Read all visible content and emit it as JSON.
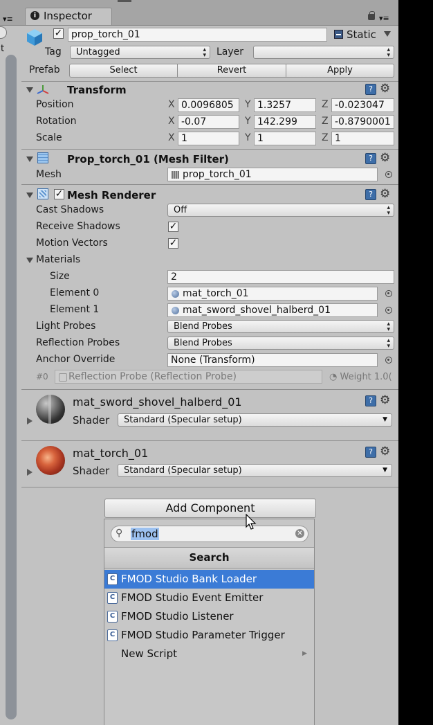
{
  "tab": {
    "title": "Inspector"
  },
  "header": {
    "object_name": "prop_torch_01",
    "static_label": "Static",
    "tag_label": "Tag",
    "tag_value": "Untagged",
    "layer_label": "Layer",
    "layer_value": "",
    "prefab_label": "Prefab",
    "select_label": "Select",
    "revert_label": "Revert",
    "apply_label": "Apply"
  },
  "transform": {
    "title": "Transform",
    "rows": [
      {
        "label": "Position",
        "x": "0.0096805",
        "y": "1.3257",
        "z": "-0.023047"
      },
      {
        "label": "Rotation",
        "x": "-0.07",
        "y": "142.299",
        "z": "-0.8790001"
      },
      {
        "label": "Scale",
        "x": "1",
        "y": "1",
        "z": "1"
      }
    ],
    "axis_x": "X",
    "axis_y": "Y",
    "axis_z": "Z"
  },
  "mesh_filter": {
    "title": "Prop_torch_01 (Mesh Filter)",
    "mesh_label": "Mesh",
    "mesh_value": "prop_torch_01"
  },
  "mesh_renderer": {
    "title": "Mesh Renderer",
    "cast_shadows_label": "Cast Shadows",
    "cast_shadows_value": "Off",
    "receive_shadows_label": "Receive Shadows",
    "motion_vectors_label": "Motion Vectors",
    "materials_label": "Materials",
    "size_label": "Size",
    "size_value": "2",
    "element0_label": "Element 0",
    "element0_value": "mat_torch_01",
    "element1_label": "Element 1",
    "element1_value": "mat_sword_shovel_halberd_01",
    "light_probes_label": "Light Probes",
    "light_probes_value": "Blend Probes",
    "reflection_probes_label": "Reflection Probes",
    "reflection_probes_value": "Blend Probes",
    "anchor_override_label": "Anchor Override",
    "anchor_override_value": "None (Transform)",
    "probe_index": "#0",
    "probe_name": "Reflection Probe (Reflection Probe)",
    "weight_text": "Weight 1.0("
  },
  "materials": [
    {
      "name": "mat_sword_shovel_halberd_01",
      "shader_label": "Shader",
      "shader_value": "Standard (Specular setup)"
    },
    {
      "name": "mat_torch_01",
      "shader_label": "Shader",
      "shader_value": "Standard (Specular setup)"
    }
  ],
  "add_component": {
    "button_label": "Add Component",
    "search_value": "fmod",
    "section_title": "Search",
    "items": [
      {
        "label": "FMOD Studio Bank Loader",
        "selected": true
      },
      {
        "label": "FMOD Studio Event Emitter",
        "selected": false
      },
      {
        "label": "FMOD Studio Listener",
        "selected": false
      },
      {
        "label": "FMOD Studio Parameter Trigger",
        "selected": false
      }
    ],
    "new_script_label": "New Script"
  },
  "colors": {
    "selection": "#3b7bd6",
    "panel": "#c2c2c2",
    "tabbar": "#a5a5a5"
  }
}
